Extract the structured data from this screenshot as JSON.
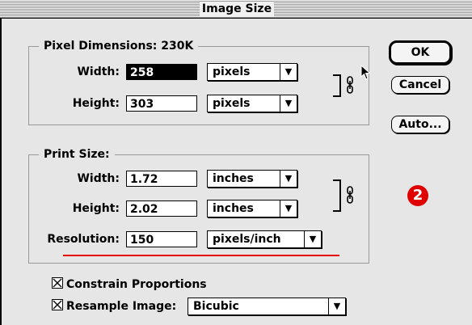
{
  "dialog": {
    "title": "Image Size"
  },
  "pixel_dimensions": {
    "label": "Pixel Dimensions: 230K",
    "width_label": "Width:",
    "width_value": "258",
    "width_unit": "pixels",
    "height_label": "Height:",
    "height_value": "303",
    "height_unit": "pixels"
  },
  "print_size": {
    "label": "Print Size:",
    "width_label": "Width:",
    "width_value": "1.72",
    "width_unit": "inches",
    "height_label": "Height:",
    "height_value": "2.02",
    "height_unit": "inches",
    "resolution_label": "Resolution:",
    "resolution_value": "150",
    "resolution_unit": "pixels/inch"
  },
  "buttons": {
    "ok": "OK",
    "cancel": "Cancel",
    "auto": "Auto..."
  },
  "options": {
    "constrain_label": "Constrain Proportions",
    "constrain_checked": true,
    "resample_label": "Resample Image:",
    "resample_checked": true,
    "resample_method": "Bicubic"
  },
  "annotation": {
    "step_number": "2",
    "accent_color": "#e00000"
  },
  "icons": {
    "link": "chain-link-icon",
    "cursor": "arrow-cursor-icon",
    "dropdown": "triangle-down-icon"
  }
}
